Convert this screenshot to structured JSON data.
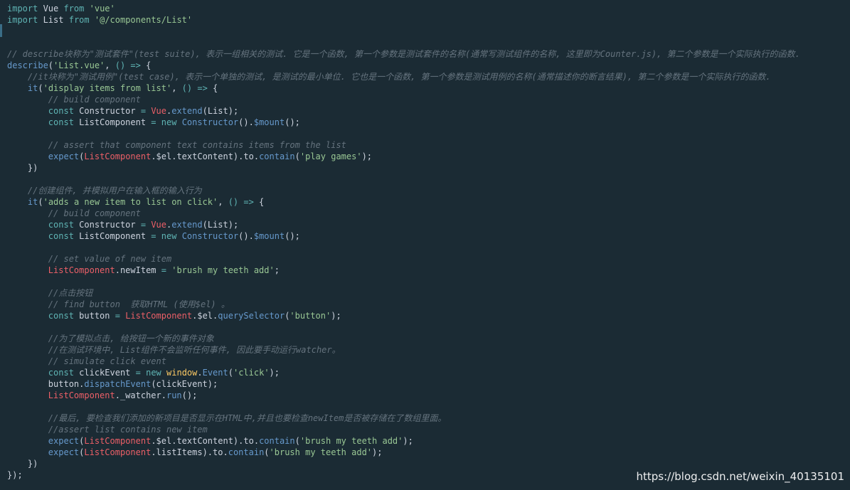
{
  "editor": {
    "language": "javascript",
    "colors": {
      "background": "#1b2b34",
      "plain": "#cdd3de",
      "keyword": "#5fb4b4",
      "string": "#99c794",
      "comment": "#65737e",
      "function": "#6699cc",
      "class": "#fac863",
      "variable": "#ec5f67"
    },
    "lines": [
      [
        [
          "keyword",
          "import"
        ],
        [
          "plain",
          " Vue "
        ],
        [
          "keyword",
          "from"
        ],
        [
          "plain",
          " "
        ],
        [
          "string",
          "'vue'"
        ]
      ],
      [
        [
          "keyword",
          "import"
        ],
        [
          "plain",
          " List "
        ],
        [
          "keyword",
          "from"
        ],
        [
          "plain",
          " "
        ],
        [
          "string",
          "'@/components/List'"
        ]
      ],
      [],
      [],
      [
        [
          "comment",
          "// describe块称为\"测试套件\"(test suite), 表示一组相关的测试. 它是一个函数, 第一个参数是测试套件的名称(通常写测试组件的名称, 这里即为Counter.js), 第二个参数是一个实际执行的函数."
        ]
      ],
      [
        [
          "func",
          "describe"
        ],
        [
          "punct",
          "("
        ],
        [
          "string",
          "'List.vue'"
        ],
        [
          "punct",
          ", "
        ],
        [
          "op",
          "() =>"
        ],
        [
          "punct",
          " {"
        ]
      ],
      [
        [
          "plain",
          "    "
        ],
        [
          "comment",
          "//it块称为\"测试用例\"(test case), 表示一个单独的测试, 是测试的最小单位. 它也是一个函数, 第一个参数是测试用例的名称(通常描述你的断言结果), 第二个参数是一个实际执行的函数."
        ]
      ],
      [
        [
          "plain",
          "    "
        ],
        [
          "func",
          "it"
        ],
        [
          "punct",
          "("
        ],
        [
          "string",
          "'display items from list'"
        ],
        [
          "punct",
          ", "
        ],
        [
          "op",
          "() =>"
        ],
        [
          "punct",
          " {"
        ]
      ],
      [
        [
          "plain",
          "        "
        ],
        [
          "comment",
          "// build component"
        ]
      ],
      [
        [
          "plain",
          "        "
        ],
        [
          "keyword",
          "const"
        ],
        [
          "plain",
          " Constructor "
        ],
        [
          "op",
          "="
        ],
        [
          "plain",
          " "
        ],
        [
          "var",
          "Vue"
        ],
        [
          "punct",
          "."
        ],
        [
          "func",
          "extend"
        ],
        [
          "punct",
          "(List);"
        ]
      ],
      [
        [
          "plain",
          "        "
        ],
        [
          "keyword",
          "const"
        ],
        [
          "plain",
          " ListComponent "
        ],
        [
          "op",
          "="
        ],
        [
          "plain",
          " "
        ],
        [
          "keyword",
          "new"
        ],
        [
          "plain",
          " "
        ],
        [
          "func",
          "Constructor"
        ],
        [
          "punct",
          "()."
        ],
        [
          "func",
          "$mount"
        ],
        [
          "punct",
          "();"
        ]
      ],
      [],
      [
        [
          "plain",
          "        "
        ],
        [
          "comment",
          "// assert that component text contains items from the list"
        ]
      ],
      [
        [
          "plain",
          "        "
        ],
        [
          "func",
          "expect"
        ],
        [
          "punct",
          "("
        ],
        [
          "var",
          "ListComponent"
        ],
        [
          "punct",
          "."
        ],
        [
          "plain",
          "$el.textContent"
        ],
        [
          "punct",
          ")."
        ],
        [
          "plain",
          "to"
        ],
        [
          "punct",
          "."
        ],
        [
          "func",
          "contain"
        ],
        [
          "punct",
          "("
        ],
        [
          "string",
          "'play games'"
        ],
        [
          "punct",
          ");"
        ]
      ],
      [
        [
          "plain",
          "    "
        ],
        [
          "punct",
          "})"
        ]
      ],
      [],
      [
        [
          "plain",
          "    "
        ],
        [
          "comment",
          "//创建组件, 并模拟用户在输入框的输入行为"
        ]
      ],
      [
        [
          "plain",
          "    "
        ],
        [
          "func",
          "it"
        ],
        [
          "punct",
          "("
        ],
        [
          "string",
          "'adds a new item to list on click'"
        ],
        [
          "punct",
          ", "
        ],
        [
          "op",
          "() =>"
        ],
        [
          "punct",
          " {"
        ]
      ],
      [
        [
          "plain",
          "        "
        ],
        [
          "comment",
          "// build component"
        ]
      ],
      [
        [
          "plain",
          "        "
        ],
        [
          "keyword",
          "const"
        ],
        [
          "plain",
          " Constructor "
        ],
        [
          "op",
          "="
        ],
        [
          "plain",
          " "
        ],
        [
          "var",
          "Vue"
        ],
        [
          "punct",
          "."
        ],
        [
          "func",
          "extend"
        ],
        [
          "punct",
          "(List);"
        ]
      ],
      [
        [
          "plain",
          "        "
        ],
        [
          "keyword",
          "const"
        ],
        [
          "plain",
          " ListComponent "
        ],
        [
          "op",
          "="
        ],
        [
          "plain",
          " "
        ],
        [
          "keyword",
          "new"
        ],
        [
          "plain",
          " "
        ],
        [
          "func",
          "Constructor"
        ],
        [
          "punct",
          "()."
        ],
        [
          "func",
          "$mount"
        ],
        [
          "punct",
          "();"
        ]
      ],
      [],
      [
        [
          "plain",
          "        "
        ],
        [
          "comment",
          "// set value of new item"
        ]
      ],
      [
        [
          "plain",
          "        "
        ],
        [
          "var",
          "ListComponent"
        ],
        [
          "punct",
          "."
        ],
        [
          "plain",
          "newItem "
        ],
        [
          "op",
          "="
        ],
        [
          "plain",
          " "
        ],
        [
          "string",
          "'brush my teeth add'"
        ],
        [
          "punct",
          ";"
        ]
      ],
      [],
      [
        [
          "plain",
          "        "
        ],
        [
          "comment",
          "//点击按钮"
        ]
      ],
      [
        [
          "plain",
          "        "
        ],
        [
          "comment",
          "// find button  获取HTML (使用$el) 。"
        ]
      ],
      [
        [
          "plain",
          "        "
        ],
        [
          "keyword",
          "const"
        ],
        [
          "plain",
          " button "
        ],
        [
          "op",
          "="
        ],
        [
          "plain",
          " "
        ],
        [
          "var",
          "ListComponent"
        ],
        [
          "punct",
          "."
        ],
        [
          "plain",
          "$el"
        ],
        [
          "punct",
          "."
        ],
        [
          "func",
          "querySelector"
        ],
        [
          "punct",
          "("
        ],
        [
          "string",
          "'button'"
        ],
        [
          "punct",
          ");"
        ]
      ],
      [],
      [
        [
          "plain",
          "        "
        ],
        [
          "comment",
          "//为了模拟点击, 给按钮一个新的事件对象"
        ]
      ],
      [
        [
          "plain",
          "        "
        ],
        [
          "comment",
          "//在测试环境中, List组件不会监听任何事件, 因此要手动运行watcher。"
        ]
      ],
      [
        [
          "plain",
          "        "
        ],
        [
          "comment",
          "// simulate click event"
        ]
      ],
      [
        [
          "plain",
          "        "
        ],
        [
          "keyword",
          "const"
        ],
        [
          "plain",
          " clickEvent "
        ],
        [
          "op",
          "="
        ],
        [
          "plain",
          " "
        ],
        [
          "keyword",
          "new"
        ],
        [
          "plain",
          " "
        ],
        [
          "class",
          "window"
        ],
        [
          "punct",
          "."
        ],
        [
          "func",
          "Event"
        ],
        [
          "punct",
          "("
        ],
        [
          "string",
          "'click'"
        ],
        [
          "punct",
          ");"
        ]
      ],
      [
        [
          "plain",
          "        "
        ],
        [
          "plain",
          "button"
        ],
        [
          "punct",
          "."
        ],
        [
          "func",
          "dispatchEvent"
        ],
        [
          "punct",
          "(clickEvent);"
        ]
      ],
      [
        [
          "plain",
          "        "
        ],
        [
          "var",
          "ListComponent"
        ],
        [
          "punct",
          "."
        ],
        [
          "plain",
          "_watcher"
        ],
        [
          "punct",
          "."
        ],
        [
          "func",
          "run"
        ],
        [
          "punct",
          "();"
        ]
      ],
      [],
      [
        [
          "plain",
          "        "
        ],
        [
          "comment",
          "//最后, 要检查我们添加的新项目是否显示在HTML中,并且也要检查newItem是否被存储在了数组里面。"
        ]
      ],
      [
        [
          "plain",
          "        "
        ],
        [
          "comment",
          "//assert list contains new item"
        ]
      ],
      [
        [
          "plain",
          "        "
        ],
        [
          "func",
          "expect"
        ],
        [
          "punct",
          "("
        ],
        [
          "var",
          "ListComponent"
        ],
        [
          "punct",
          "."
        ],
        [
          "plain",
          "$el.textContent"
        ],
        [
          "punct",
          ")."
        ],
        [
          "plain",
          "to"
        ],
        [
          "punct",
          "."
        ],
        [
          "func",
          "contain"
        ],
        [
          "punct",
          "("
        ],
        [
          "string",
          "'brush my teeth add'"
        ],
        [
          "punct",
          ");"
        ]
      ],
      [
        [
          "plain",
          "        "
        ],
        [
          "func",
          "expect"
        ],
        [
          "punct",
          "("
        ],
        [
          "var",
          "ListComponent"
        ],
        [
          "punct",
          "."
        ],
        [
          "plain",
          "listItems"
        ],
        [
          "punct",
          ")."
        ],
        [
          "plain",
          "to"
        ],
        [
          "punct",
          "."
        ],
        [
          "func",
          "contain"
        ],
        [
          "punct",
          "("
        ],
        [
          "string",
          "'brush my teeth add'"
        ],
        [
          "punct",
          ");"
        ]
      ],
      [
        [
          "plain",
          "    "
        ],
        [
          "punct",
          "})"
        ]
      ],
      [
        [
          "punct",
          "});"
        ]
      ]
    ]
  },
  "watermark": {
    "text": "https://blog.csdn.net/weixin_40135101"
  }
}
